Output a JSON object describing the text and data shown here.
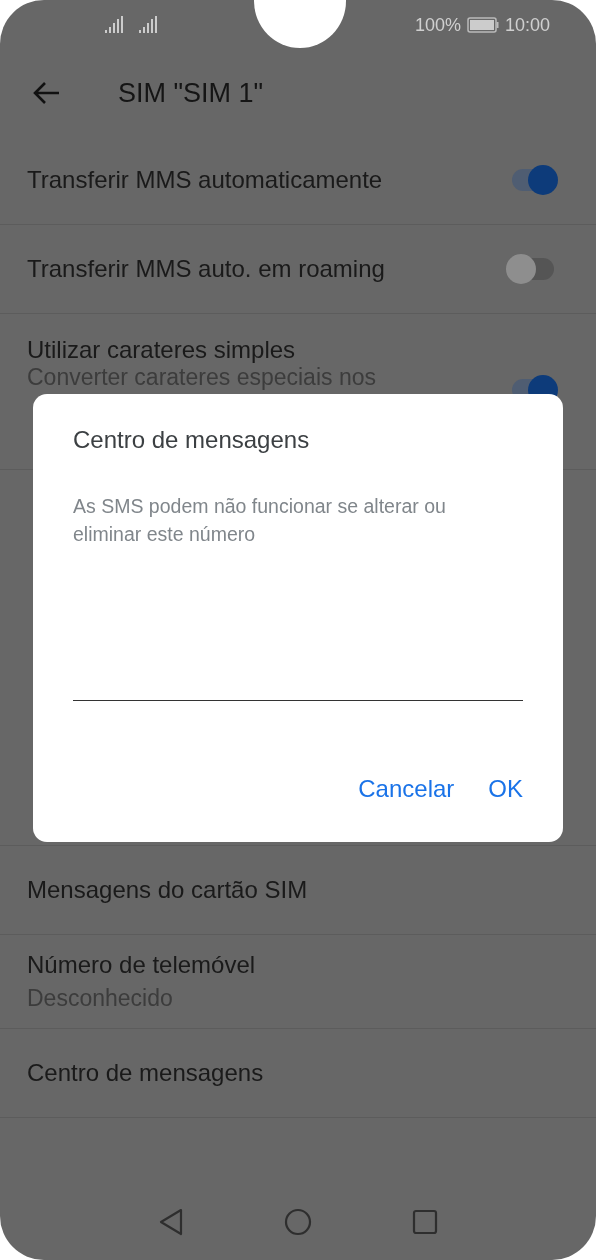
{
  "status_bar": {
    "battery": "100%",
    "time": "10:00"
  },
  "header": {
    "title": "SIM \"SIM 1\""
  },
  "settings": [
    {
      "kind": "toggle",
      "title": "Transferir MMS automaticamente",
      "on": true
    },
    {
      "kind": "toggle",
      "title": "Transferir MMS auto. em roaming",
      "on": false
    },
    {
      "kind": "toggle",
      "title": "Utilizar carateres simples",
      "subtitle": "Converter carateres especiais nos",
      "on": true
    }
  ],
  "settings_below": [
    {
      "kind": "plain",
      "title": "Mensagens do cartão SIM"
    },
    {
      "kind": "plain",
      "title": "Número de telemóvel",
      "subtitle": "Desconhecido"
    },
    {
      "kind": "plain",
      "title": "Centro de mensagens"
    }
  ],
  "dialog": {
    "title": "Centro de mensagens",
    "message": "As SMS podem não funcionar se alterar ou eliminar este número",
    "buttons": [
      "Cancelar",
      "OK"
    ]
  }
}
